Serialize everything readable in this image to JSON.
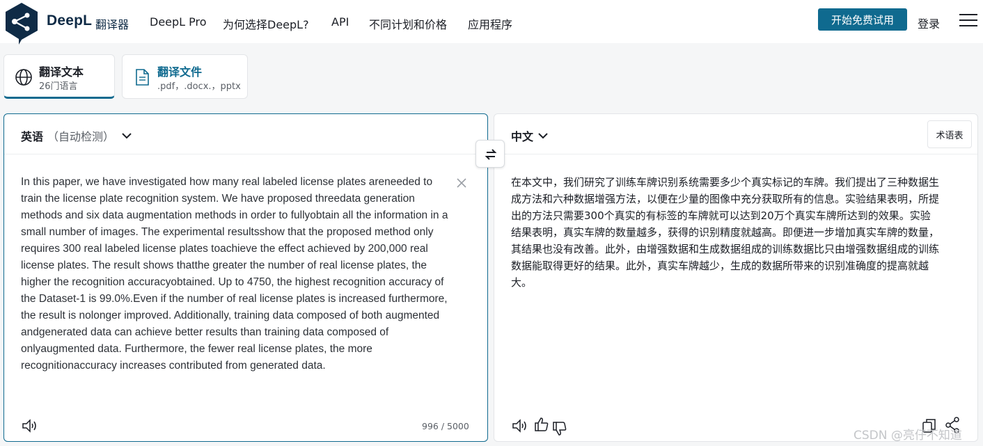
{
  "header": {
    "brand": "DeepL",
    "brand_sub": "翻译器",
    "nav": [
      "DeepL Pro",
      "为何选择DeepL?",
      "API",
      "不同计划和价格",
      "应用程序"
    ],
    "cta": "开始免费试用",
    "login": "登录"
  },
  "tabs": [
    {
      "title": "翻译文本",
      "sub": "26门语言"
    },
    {
      "title": "翻译文件",
      "sub": ".pdf，.docx.，pptx"
    }
  ],
  "source": {
    "language": "英语",
    "hint": "（自动检测）",
    "text": "In this paper, we have investigated how many real labeled license plates areneeded to train the license plate recognition system. We have proposed threedata generation methods and six data augmentation methods in order to fullyobtain all the information in a small number of images. The experimental resultsshow that the proposed method only requires 300 real labeled license plates toachieve the effect achieved by 200,000 real license plates. The result shows thatthe greater the number of real license plates, the higher the recognition accuracyobtained. Up to 4750, the highest recognition accuracy of the Dataset-1 is 99.0%.Even if the number of real license plates is increased furthermore, the result is nolonger improved. Additionally, training data composed of both augmented andgenerated data can achieve better results than training data composed of onlyaugmented data. Furthermore, the fewer real license plates, the more recognitionaccuracy increases contributed from generated data.",
    "char_count": "996 / 5000"
  },
  "target": {
    "language": "中文",
    "glossary": "术语表",
    "text": "在本文中，我们研究了训练车牌识别系统需要多少个真实标记的车牌。我们提出了三种数据生成方法和六种数据增强方法，以便在少量的图像中充分获取所有的信息。实验结果表明，所提出的方法只需要300个真实的有标签的车牌就可以达到20万个真实车牌所达到的效果。实验结果表明，真实车牌的数量越多，获得的识别精度就越高。即便进一步增加真实车牌的数量，其结果也没有改善。此外，由增强数据和生成数据组成的训练数据比只由增强数据组成的训练数据能取得更好的结果。此外，真实车牌越少，生成的数据所带来的识别准确度的提高就越大。"
  },
  "watermark": "CSDN @亮仔不知道",
  "icons": {
    "logo": "deepl-logo-icon",
    "text_tab": "globe-icon",
    "file_tab": "document-icon",
    "swap": "swap-icon",
    "clear": "close-icon",
    "speaker": "speaker-icon",
    "thumbs_up": "thumbs-up-icon",
    "thumbs_down": "thumbs-down-icon",
    "copy": "copy-icon",
    "share": "share-icon",
    "menu": "hamburger-menu-icon"
  },
  "colors": {
    "brand_navy": "#0f2b46",
    "accent": "#0f6a8f",
    "background": "#f5f6f7"
  }
}
